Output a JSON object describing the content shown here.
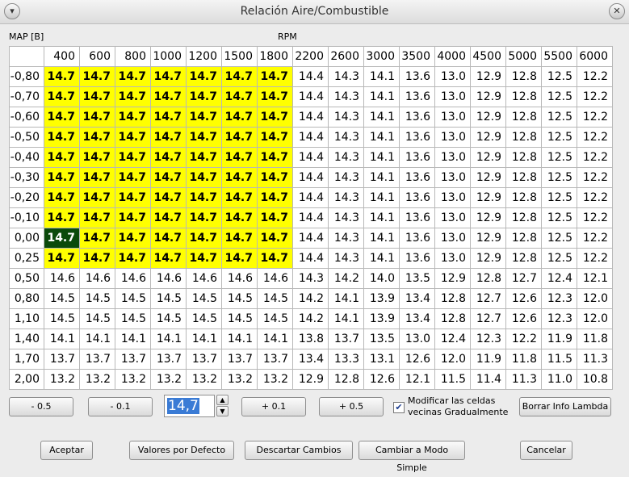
{
  "window": {
    "title": "Relación Aire/Combustible",
    "menu_icon": "chevron-down-icon",
    "close_icon": "close-icon"
  },
  "labels": {
    "map_axis": "MAP [B]",
    "rpm_axis": "RPM"
  },
  "table": {
    "columns": [
      "400",
      "600",
      "800",
      "1000",
      "1200",
      "1500",
      "1800",
      "2200",
      "2600",
      "3000",
      "3500",
      "4000",
      "4500",
      "5000",
      "5500",
      "6000"
    ],
    "rows": [
      {
        "map": "-0,80",
        "values": [
          "14.7",
          "14.7",
          "14.7",
          "14.7",
          "14.7",
          "14.7",
          "14.7",
          "14.4",
          "14.3",
          "14.1",
          "13.6",
          "13.0",
          "12.9",
          "12.8",
          "12.5",
          "12.2"
        ]
      },
      {
        "map": "-0,70",
        "values": [
          "14.7",
          "14.7",
          "14.7",
          "14.7",
          "14.7",
          "14.7",
          "14.7",
          "14.4",
          "14.3",
          "14.1",
          "13.6",
          "13.0",
          "12.9",
          "12.8",
          "12.5",
          "12.2"
        ]
      },
      {
        "map": "-0,60",
        "values": [
          "14.7",
          "14.7",
          "14.7",
          "14.7",
          "14.7",
          "14.7",
          "14.7",
          "14.4",
          "14.3",
          "14.1",
          "13.6",
          "13.0",
          "12.9",
          "12.8",
          "12.5",
          "12.2"
        ]
      },
      {
        "map": "-0,50",
        "values": [
          "14.7",
          "14.7",
          "14.7",
          "14.7",
          "14.7",
          "14.7",
          "14.7",
          "14.4",
          "14.3",
          "14.1",
          "13.6",
          "13.0",
          "12.9",
          "12.8",
          "12.5",
          "12.2"
        ]
      },
      {
        "map": "-0,40",
        "values": [
          "14.7",
          "14.7",
          "14.7",
          "14.7",
          "14.7",
          "14.7",
          "14.7",
          "14.4",
          "14.3",
          "14.1",
          "13.6",
          "13.0",
          "12.9",
          "12.8",
          "12.5",
          "12.2"
        ]
      },
      {
        "map": "-0,30",
        "values": [
          "14.7",
          "14.7",
          "14.7",
          "14.7",
          "14.7",
          "14.7",
          "14.7",
          "14.4",
          "14.3",
          "14.1",
          "13.6",
          "13.0",
          "12.9",
          "12.8",
          "12.5",
          "12.2"
        ]
      },
      {
        "map": "-0,20",
        "values": [
          "14.7",
          "14.7",
          "14.7",
          "14.7",
          "14.7",
          "14.7",
          "14.7",
          "14.4",
          "14.3",
          "14.1",
          "13.6",
          "13.0",
          "12.9",
          "12.8",
          "12.5",
          "12.2"
        ]
      },
      {
        "map": "-0,10",
        "values": [
          "14.7",
          "14.7",
          "14.7",
          "14.7",
          "14.7",
          "14.7",
          "14.7",
          "14.4",
          "14.3",
          "14.1",
          "13.6",
          "13.0",
          "12.9",
          "12.8",
          "12.5",
          "12.2"
        ]
      },
      {
        "map": "0,00",
        "values": [
          "14.7",
          "14.7",
          "14.7",
          "14.7",
          "14.7",
          "14.7",
          "14.7",
          "14.4",
          "14.3",
          "14.1",
          "13.6",
          "13.0",
          "12.9",
          "12.8",
          "12.5",
          "12.2"
        ]
      },
      {
        "map": "0,25",
        "values": [
          "14.7",
          "14.7",
          "14.7",
          "14.7",
          "14.7",
          "14.7",
          "14.7",
          "14.4",
          "14.3",
          "14.1",
          "13.6",
          "13.0",
          "12.9",
          "12.8",
          "12.5",
          "12.2"
        ]
      },
      {
        "map": "0,50",
        "values": [
          "14.6",
          "14.6",
          "14.6",
          "14.6",
          "14.6",
          "14.6",
          "14.6",
          "14.3",
          "14.2",
          "14.0",
          "13.5",
          "12.9",
          "12.8",
          "12.7",
          "12.4",
          "12.1"
        ]
      },
      {
        "map": "0,80",
        "values": [
          "14.5",
          "14.5",
          "14.5",
          "14.5",
          "14.5",
          "14.5",
          "14.5",
          "14.2",
          "14.1",
          "13.9",
          "13.4",
          "12.8",
          "12.7",
          "12.6",
          "12.3",
          "12.0"
        ]
      },
      {
        "map": "1,10",
        "values": [
          "14.5",
          "14.5",
          "14.5",
          "14.5",
          "14.5",
          "14.5",
          "14.5",
          "14.2",
          "14.1",
          "13.9",
          "13.4",
          "12.8",
          "12.7",
          "12.6",
          "12.3",
          "12.0"
        ]
      },
      {
        "map": "1,40",
        "values": [
          "14.1",
          "14.1",
          "14.1",
          "14.1",
          "14.1",
          "14.1",
          "14.1",
          "13.8",
          "13.7",
          "13.5",
          "13.0",
          "12.4",
          "12.3",
          "12.2",
          "11.9",
          "11.8"
        ]
      },
      {
        "map": "1,70",
        "values": [
          "13.7",
          "13.7",
          "13.7",
          "13.7",
          "13.7",
          "13.7",
          "13.7",
          "13.4",
          "13.3",
          "13.1",
          "12.6",
          "12.0",
          "11.9",
          "11.8",
          "11.5",
          "11.3"
        ]
      },
      {
        "map": "2,00",
        "values": [
          "13.2",
          "13.2",
          "13.2",
          "13.2",
          "13.2",
          "13.2",
          "13.2",
          "12.9",
          "12.8",
          "12.6",
          "12.1",
          "11.5",
          "11.4",
          "11.3",
          "11.0",
          "10.8"
        ]
      }
    ],
    "highlighted_rows": 10,
    "highlighted_cols": 7,
    "selected_row": 8,
    "selected_col": 0,
    "highlight_color": "#ffff00",
    "selected_color": "#0b4a0b"
  },
  "controls": {
    "minus_05": "- 0.5",
    "minus_01": "- 0.1",
    "spin_value": "14,7",
    "spin_up_icon": "triangle-up-icon",
    "spin_down_icon": "triangle-down-icon",
    "plus_01": "+ 0.1",
    "plus_05": "+ 0.5",
    "gradual_checked": true,
    "gradual_label_line1": "Modificar las celdas",
    "gradual_label_line2": "vecinas Gradualmente",
    "clear_lambda": "Borrar Info Lambda"
  },
  "footer": {
    "accept": "Aceptar",
    "defaults": "Valores por Defecto",
    "discard": "Descartar Cambios",
    "simple_mode": "Cambiar a Modo Simple",
    "cancel": "Cancelar"
  }
}
